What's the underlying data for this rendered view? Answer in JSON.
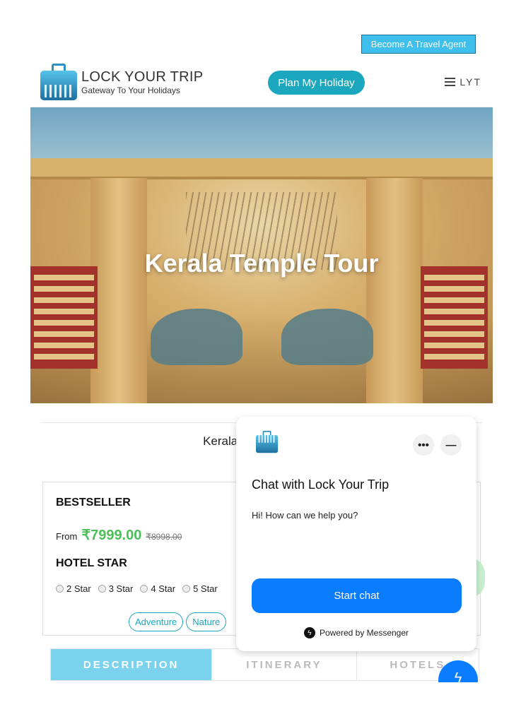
{
  "top": {
    "agent_button": "Become A Travel Agent"
  },
  "header": {
    "logo_title": "LOCK YOUR TRIP",
    "logo_tagline": "Gateway To Your Holidays",
    "plan_button": "Plan My Holiday",
    "menu_label": "LYT"
  },
  "hero": {
    "title": "Kerala Temple Tour"
  },
  "tour": {
    "name": "Kerala Temple Tour",
    "badge": "BESTSELLER",
    "from_label": "From",
    "price": "₹7999.00",
    "old_price": "₹8998.00",
    "hotel_star_label": "HOTEL STAR",
    "star_options": [
      "2 Star",
      "3 Star",
      "4 Star",
      "5 Star"
    ],
    "tags": [
      "Adventure",
      "Nature"
    ]
  },
  "tabs": [
    {
      "label": "DESCRIPTION",
      "active": true
    },
    {
      "label": "ITINERARY"
    },
    {
      "label": "HOTELS"
    }
  ],
  "chat": {
    "title": "Chat with Lock Your Trip",
    "message": "Hi! How can we help you?",
    "start_button": "Start chat",
    "powered": "Powered by Messenger",
    "more": "•••",
    "minimize": "—"
  },
  "colors": {
    "accent": "#1ba7bd",
    "agent_button": "#3fbfeb",
    "price": "#4cbf5a",
    "active_tab": "#7bd2ec",
    "messenger": "#0a7cff"
  }
}
